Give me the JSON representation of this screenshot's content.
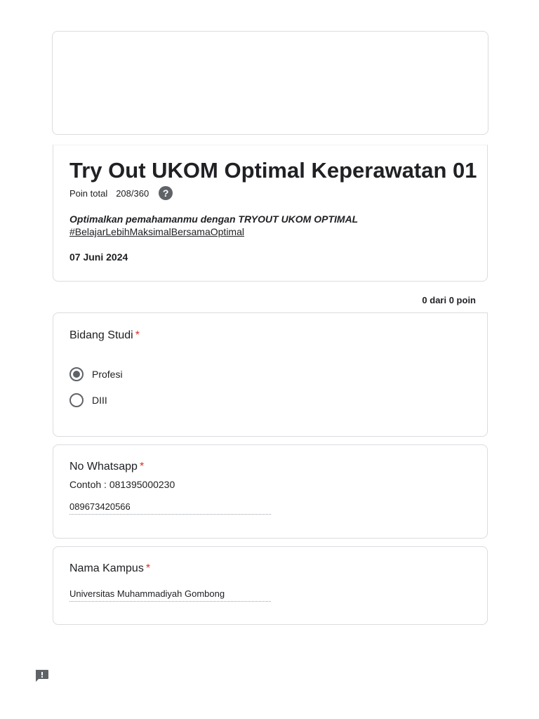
{
  "form": {
    "title": "Try Out UKOM Optimal Keperawatan 01",
    "score_label": "Poin total",
    "score_value": "208/360",
    "help_icon": "?",
    "description_line1": "Optimalkan pemahamanmu dengan TRYOUT UKOM OPTIMAL",
    "description_line2": "#BelajarLebihMaksimalBersamaOptimal",
    "date": "07 Juni 2024"
  },
  "points_summary": "0 dari 0 poin",
  "questions": [
    {
      "title": "Bidang Studi",
      "required_mark": "*",
      "options": [
        {
          "label": "Profesi",
          "selected": true
        },
        {
          "label": "DIII",
          "selected": false
        }
      ]
    },
    {
      "title": "No Whatsapp",
      "required_mark": "*",
      "help_text": "Contoh : 081395000230",
      "answer": "089673420566"
    },
    {
      "title": "Nama Kampus",
      "required_mark": "*",
      "answer": "Universitas Muhammadiyah Gombong"
    }
  ],
  "icons": {
    "help": "question-circle-icon",
    "feedback": "report-feedback-icon"
  },
  "colors": {
    "required": "#d93025",
    "border": "#dadce0",
    "icon": "#5f6368"
  }
}
